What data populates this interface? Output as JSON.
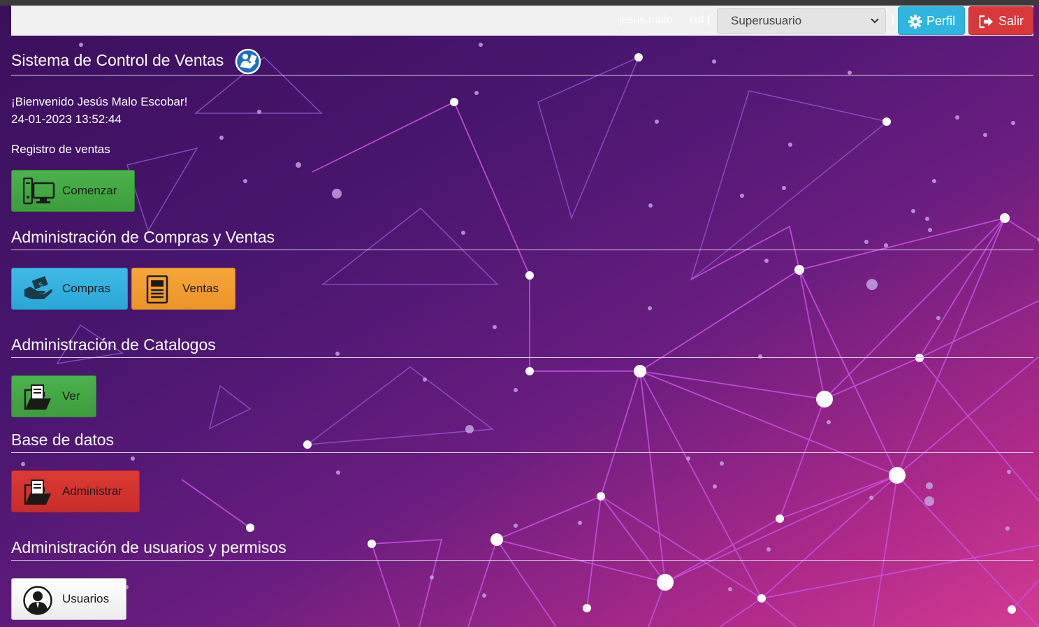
{
  "header": {
    "username": "jesus.malo",
    "rol_label": "rol (",
    "rol_close": ")",
    "role_selected": "Superusuario",
    "perfil_label": "Perfil",
    "salir_label": "Salir"
  },
  "page": {
    "title": "Sistema de Control de Ventas",
    "welcome": "¡Bienvenido Jesús Malo Escobar!",
    "datetime": "24-01-2023 13:52:44",
    "registro_label": "Registro de ventas"
  },
  "sections": {
    "registro": {
      "button": "Comenzar"
    },
    "compras_ventas": {
      "heading": "Administración de Compras y Ventas",
      "compras": "Compras",
      "ventas": "Ventas"
    },
    "catalogos": {
      "heading": "Administración de Catalogos",
      "button": "Ver"
    },
    "base_datos": {
      "heading": "Base de datos",
      "button": "Administrar"
    },
    "usuarios": {
      "heading": "Administración de usuarios y permisos",
      "button": "Usuarios"
    }
  },
  "icons": {
    "title": "user-book-icon",
    "perfil": "gear-icon",
    "salir": "sign-out-icon",
    "comenzar": "computer-icon",
    "compras": "payment-hand-icon",
    "ventas": "document-icon",
    "ver": "folder-document-icon",
    "administrar": "folder-document-icon",
    "usuarios": "user-avatar-icon"
  },
  "colors": {
    "green": "#3fa33f",
    "blue": "#2fb5e0",
    "orange": "#f0a030",
    "red": "#d9383a"
  }
}
